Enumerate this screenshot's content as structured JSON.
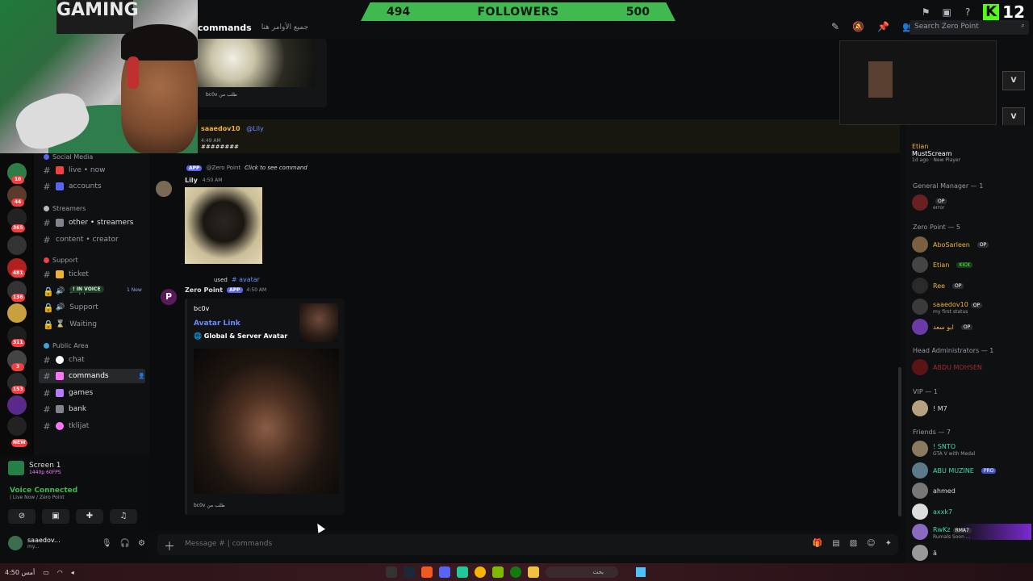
{
  "webcam": {
    "banner_text": "GAMING"
  },
  "followers_goal": {
    "current": "494",
    "label": "FOLLOWERS",
    "goal": "500"
  },
  "kick": {
    "logo": "K",
    "viewers": "12"
  },
  "header": {
    "channel_name": "commands",
    "topic": "جميع الأوامر هنا",
    "search_placeholder": "Search Zero Point"
  },
  "sidebar": {
    "categories": [
      {
        "label": "Social Media",
        "color": "#5865f2"
      },
      {
        "label": "Streamers",
        "color": "#b5bac1"
      },
      {
        "label": "Support",
        "color": "#f23f42"
      },
      {
        "label": "Public Area",
        "color": "#3ba5d8"
      }
    ],
    "channels": [
      {
        "label": "live • now",
        "type": "text"
      },
      {
        "label": "accounts",
        "type": "text"
      },
      {
        "label": "other • streamers",
        "type": "text"
      },
      {
        "label": "content • creator",
        "type": "text"
      },
      {
        "label": "ticket",
        "type": "text"
      },
      {
        "label": "Support",
        "type": "locked"
      },
      {
        "label": "Support",
        "type": "locked"
      },
      {
        "label": "Waiting",
        "type": "locked"
      },
      {
        "label": "chat",
        "type": "text"
      },
      {
        "label": "commands",
        "type": "text"
      },
      {
        "label": "games",
        "type": "text"
      },
      {
        "label": "bank",
        "type": "text"
      },
      {
        "label": "tklijat",
        "type": "text"
      }
    ],
    "voice_pill": "! IN VOICE",
    "new_label": "1 New"
  },
  "server_badges": [
    "10",
    "44",
    "365",
    "481",
    "136",
    "311",
    "3",
    "153",
    "NEW"
  ],
  "panel": {
    "screen_title": "Screen 1",
    "screen_sub": "1440p 60FPS",
    "voice_status": "Voice Connected",
    "voice_sub": "| Live Now / Zero Point",
    "username": "saaedov...",
    "user_status": "my..."
  },
  "chat": {
    "embed_footer_1": "bc0v طلب من",
    "mention_user": "saaedov10",
    "mention_target": "@Lily",
    "mention_time": "4:49 AM",
    "mention_text": "########",
    "reply_preview": "@Zero Point",
    "reply_cmd": "Click to see command",
    "lily_name": "Lily",
    "lily_time": "4:50 AM",
    "used_text": "used",
    "used_cmd": "# avatar",
    "bot_name": "Zero Point",
    "bot_badge": "APP",
    "bot_time": "4:50 AM",
    "embed_author": "bc0v",
    "embed_title": "Avatar Link",
    "embed_desc": "Global & Server Avatar",
    "embed_footer_2": "bc0v طلب من"
  },
  "input": {
    "placeholder": "Message # | commands"
  },
  "members": {
    "top_member": {
      "name": "Etian",
      "activity": "MustScream",
      "sub": "1d ago · New Player"
    },
    "groups": [
      {
        "label": "General Manager — 1",
        "members": [
          {
            "name": "",
            "tag": "OP",
            "sub": "error",
            "color": "#f23f42"
          }
        ]
      },
      {
        "label": "Zero Point — 5",
        "members": [
          {
            "name": "AboSarleen",
            "tag": "OP",
            "sub": "",
            "color": "#f0b232"
          },
          {
            "name": "Etian",
            "tag": "KICK",
            "sub": "",
            "color": "#f0b232"
          },
          {
            "name": "Ree",
            "tag": "OP",
            "sub": "",
            "color": "#f0b232"
          },
          {
            "name": "saaedov10",
            "tag": "OP",
            "sub": "my first status",
            "color": "#f0b232"
          },
          {
            "name": "ابو سعد",
            "tag": "OP",
            "sub": "",
            "color": "#f0b232"
          }
        ]
      },
      {
        "label": "Head Administrators — 1",
        "members": [
          {
            "name": "ABDU MOHSEN",
            "tag": "",
            "sub": "",
            "color": "#a12d2f"
          }
        ]
      },
      {
        "label": "VIP — 1",
        "members": [
          {
            "name": "! M7",
            "tag": "",
            "sub": "",
            "color": "#dbdee1"
          }
        ]
      },
      {
        "label": "Friends — 7",
        "members": [
          {
            "name": "! SNTO",
            "tag": "",
            "sub": "GTA V with Medal",
            "color": "#3fd9a8"
          },
          {
            "name": "ABU MUZINE",
            "tag": "PRO",
            "sub": "",
            "color": "#3fd9a8"
          },
          {
            "name": "ahmed",
            "tag": "",
            "sub": "",
            "color": "#dbdee1"
          },
          {
            "name": "axxk7",
            "tag": "",
            "sub": "",
            "color": "#3fd9a8"
          },
          {
            "name": "RwKz",
            "tag": "RMA7",
            "sub": "Rumals Soon ...",
            "color": "#3fd9a8"
          },
          {
            "name": "ä",
            "tag": "",
            "sub": "",
            "color": "#dbdee1"
          }
        ]
      }
    ]
  },
  "taskbar": {
    "search_label": "بحث",
    "clock": "أمس 4:50"
  }
}
